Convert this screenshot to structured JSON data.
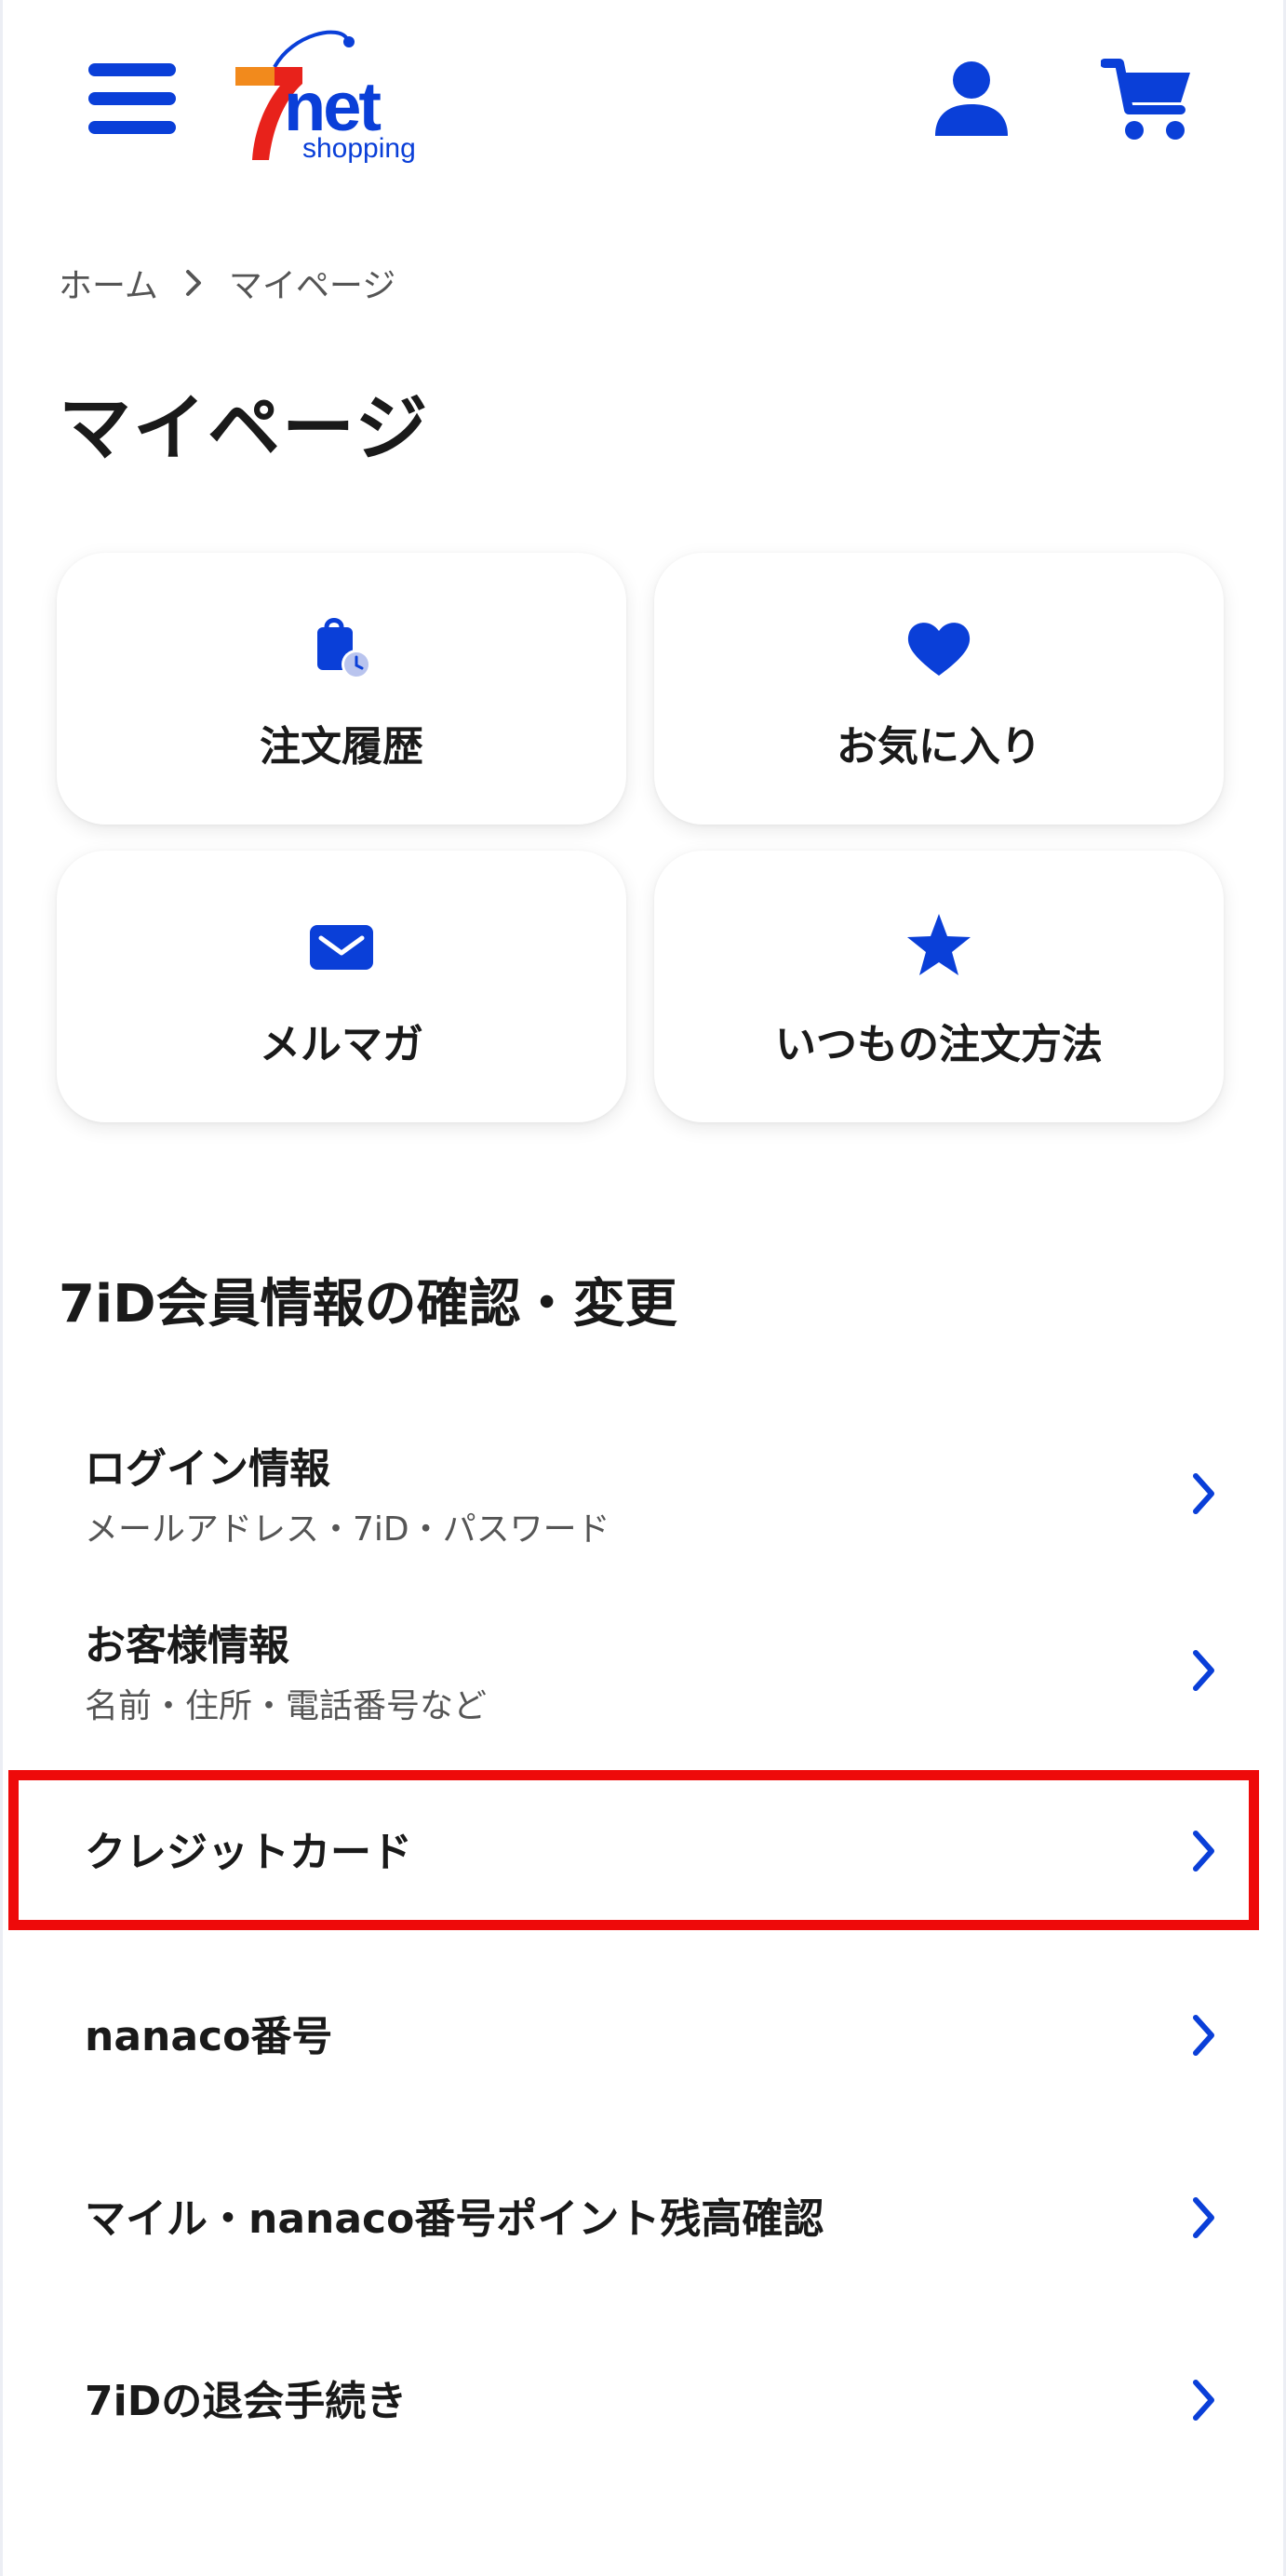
{
  "colors": {
    "accent": "#0a3fd8",
    "logo_red": "#e8221b",
    "logo_orange": "#f28a1c",
    "highlight": "#ee0a0a"
  },
  "header": {
    "menu_icon": "hamburger-menu-icon",
    "logo": {
      "numeral": "7",
      "word": "net",
      "sub": "shopping"
    },
    "user_icon": "user-icon",
    "cart_icon": "cart-icon"
  },
  "breadcrumb": {
    "items": [
      "ホーム",
      "マイページ"
    ],
    "separator_icon": "chevron-right-icon"
  },
  "page_title": "マイページ",
  "tiles": [
    {
      "label": "注文履歴",
      "icon": "shopping-bag-clock-icon"
    },
    {
      "label": "お気に入り",
      "icon": "heart-icon"
    },
    {
      "label": "メルマガ",
      "icon": "mail-icon"
    },
    {
      "label": "いつもの注文方法",
      "icon": "star-icon"
    }
  ],
  "section": {
    "title": "7iD会員情報の確認・変更"
  },
  "rows": [
    {
      "title": "ログイン情報",
      "sub": "メールアドレス・7iD・パスワード"
    },
    {
      "title": "お客様情報",
      "sub": "名前・住所・電話番号など"
    },
    {
      "title": "クレジットカード",
      "highlighted": true
    },
    {
      "title": "nanaco番号"
    },
    {
      "title": "マイル・nanaco番号ポイント残高確認"
    },
    {
      "title": "7iDの退会手続き"
    }
  ]
}
